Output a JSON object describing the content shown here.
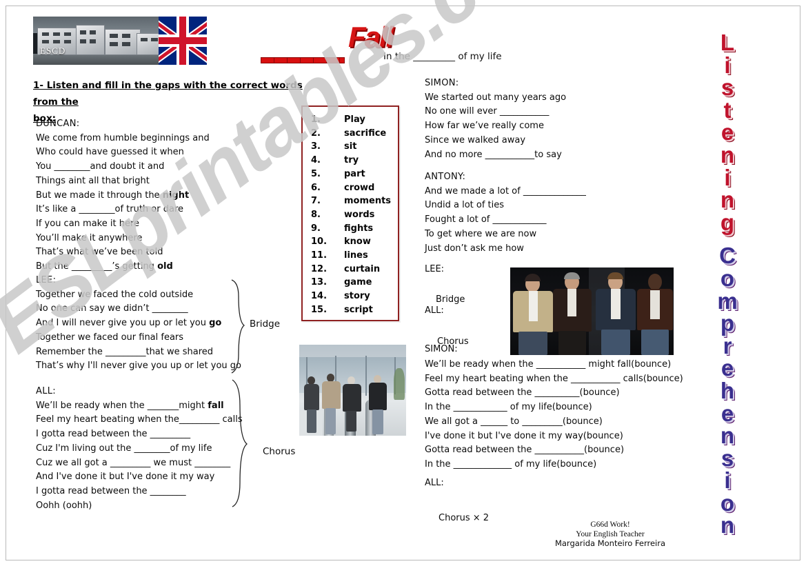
{
  "document": {
    "watermark": "ESLprintables.com",
    "school_badge": "ESCD"
  },
  "title": {
    "blank_label": "________",
    "word": "Fall",
    "subtitle": "In the _________ of my life"
  },
  "instruction": {
    "line1": "1- Listen and fill in the gaps with the correct words from the",
    "line2": "box:"
  },
  "word_box": {
    "items": [
      {
        "num": "1.",
        "word": "Play"
      },
      {
        "num": "2.",
        "word": "sacrifice"
      },
      {
        "num": "3.",
        "word": "sit"
      },
      {
        "num": "4.",
        "word": "try"
      },
      {
        "num": "5.",
        "word": "part"
      },
      {
        "num": "6.",
        "word": "crowd"
      },
      {
        "num": "7.",
        "word": "moments"
      },
      {
        "num": "8.",
        "word": "words"
      },
      {
        "num": "9.",
        "word": "fights"
      },
      {
        "num": "10.",
        "word": "know"
      },
      {
        "num": "11.",
        "word": "lines"
      },
      {
        "num": "12.",
        "word": "curtain"
      },
      {
        "num": "13.",
        "word": "game"
      },
      {
        "num": "14.",
        "word": "story"
      },
      {
        "num": "15.",
        "word": "script"
      }
    ]
  },
  "left_column": {
    "duncan": {
      "speaker": "DUNCAN:",
      "lines": [
        "We come from humble beginnings and",
        "Who could have guessed it when",
        "You ________and doubt it and",
        "Things aint all that bright",
        "But we made it through the night",
        "It’s like a ________of truth or dare",
        "If you can make it here",
        "You’ll make it anywhere",
        "That’s what we’ve been told",
        "But the _________’s getting old"
      ]
    },
    "lee": {
      "speaker": "LEE:",
      "lines": [
        "Together we faced the cold outside",
        "No one can say we didn’t ________",
        "And I will never give you up or let you go",
        "Together we faced our final fears",
        "Remember the _________that we shared",
        "That’s why I'll never give you up or let you go"
      ],
      "brace_label": "Bridge"
    },
    "all": {
      "speaker": "ALL:",
      "lines": [
        "We’ll be ready when the _______might fall",
        "Feel my heart beating when the_________ calls",
        "I gotta read between the _________",
        "Cuz I'm living out the ________of my life",
        "Cuz we all got a _________ we must ________",
        "And I've done it but I've done it my way",
        "I gotta read between the ________",
        "Oohh (oohh)"
      ],
      "brace_label": "Chorus"
    }
  },
  "right_column": {
    "simon": {
      "speaker": "SIMON:",
      "lines": [
        "We started out many years ago",
        "No one will ever ___________",
        "How far we’ve really come",
        "Since we walked away",
        "And no more ___________to say"
      ]
    },
    "antony": {
      "speaker": "ANTONY:",
      "lines": [
        "And we made a lot of ______________",
        "Undid a lot of ties",
        "Fought a lot of ____________",
        "To get where we are now",
        "Just don’t ask me how"
      ]
    },
    "lee_label": "LEE:",
    "bridge_label": "Bridge",
    "all_label": "ALL:",
    "chorus_label": "Chorus",
    "simon2_label": "SIMON:",
    "chorus_lines": [
      "We’ll be ready when the ___________ might fall(bounce)",
      "Feel my heart beating when the ___________ calls(bounce)",
      "Gotta read between the __________(bounce)",
      "In the ____________ of my life(bounce)",
      "We all got a ______  to _________(bounce)",
      "I've done it but I've done it my way(bounce)",
      "Gotta read between the ___________(bounce)",
      "In the _____________ of my life(bounce)"
    ],
    "all2_label": "ALL:",
    "chorus_x2_label": "Chorus × 2"
  },
  "side_title": {
    "word1": "Listening",
    "word2": "Comprehension",
    "color1": "#c0132c",
    "color2": "#3a2f8f"
  },
  "signature": {
    "line1": "G66d Work!",
    "line2": "Your English Teacher",
    "line3": "Margarida Monteiro Ferreira"
  }
}
